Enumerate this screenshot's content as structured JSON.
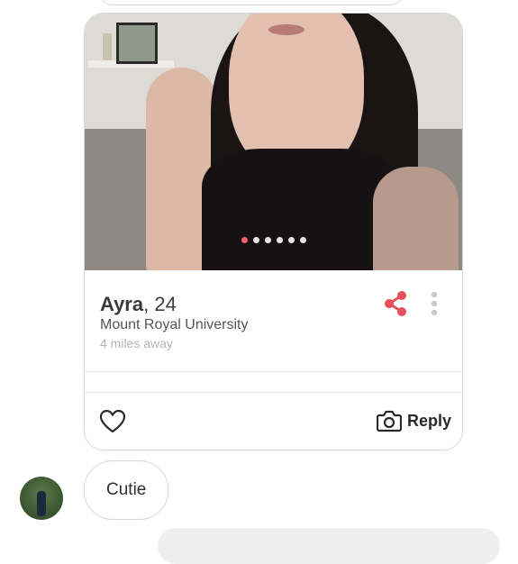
{
  "card": {
    "photo_count": 6,
    "active_photo_index": 0,
    "name": "Ayra",
    "age_text": ", 24",
    "school": "Mount Royal University",
    "distance": "4 miles away",
    "icons": {
      "share": "share-icon",
      "more": "more-vertical-icon",
      "like": "heart-icon",
      "reply": "camera-icon"
    },
    "reply_label": "Reply",
    "accent_color": "#e8505b"
  },
  "message": {
    "text": "Cutie"
  }
}
